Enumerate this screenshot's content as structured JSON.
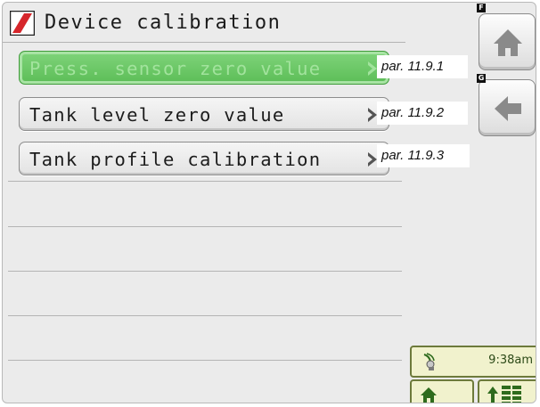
{
  "header": {
    "title": "Device calibration",
    "logo_icon": "brand-logo-icon"
  },
  "menu": {
    "items": [
      {
        "label": "Press. sensor zero value",
        "ref": "par. 11.9.1",
        "selected": true
      },
      {
        "label": "Tank level zero value",
        "ref": "par. 11.9.2",
        "selected": false
      },
      {
        "label": "Tank profile calibration",
        "ref": "par. 11.9.3",
        "selected": false
      }
    ]
  },
  "side": {
    "home_key": "F",
    "back_key": "G",
    "home_icon": "home-icon",
    "back_icon": "arrow-left-icon"
  },
  "status": {
    "time": "9:38am",
    "gps_icon": "gps-antenna-icon"
  },
  "colors": {
    "selected_fill": "#5cbd57",
    "selected_text": "#a2e39d",
    "status_bg": "#f1f2cd",
    "status_border": "#6d7a3b",
    "icon_green": "#2e6b1d",
    "button_icon_gray": "#8a8a8a"
  }
}
